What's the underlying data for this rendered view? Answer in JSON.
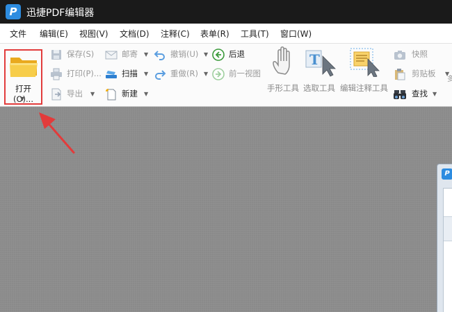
{
  "window": {
    "title": "迅捷PDF编辑器",
    "logo_letter": "P"
  },
  "menu": [
    "文件",
    "编辑(E)",
    "视图(V)",
    "文档(D)",
    "注释(C)",
    "表单(R)",
    "工具(T)",
    "窗口(W)"
  ],
  "toolbar": {
    "open": "打开(O)...",
    "save": "保存(S)",
    "print": "打印(P)...",
    "export": "导出",
    "mail": "邮寄",
    "scan": "扫描",
    "new": "新建",
    "undo": "撤销(U)",
    "redo": "重做(R)",
    "back": "后退",
    "prev_view": "前一视图",
    "hand_tool": "手形工具",
    "select_tool": "选取工具",
    "edit_annot_tool": "编辑注释工具",
    "snapshot": "快照",
    "clipboard": "剪贴板",
    "find": "查找",
    "overflow": "多"
  },
  "colors": {
    "accent": "#2d8ce0",
    "highlight_border": "#e23b3b",
    "folder": "#f5c33b"
  }
}
